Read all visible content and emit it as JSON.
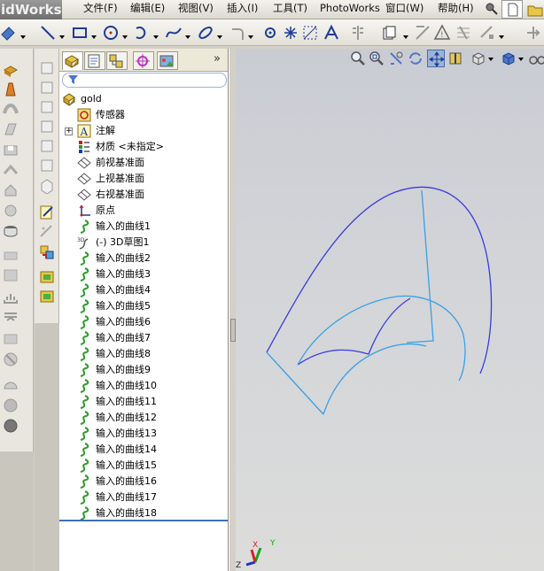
{
  "app": {
    "title": "idWorks"
  },
  "menu": {
    "items": [
      "文件(F)",
      "编辑(E)",
      "视图(V)",
      "插入(I)",
      "工具(T)",
      "PhotoWorks",
      "窗口(W)",
      "帮助(H)"
    ]
  },
  "colors": {
    "curve_dark": "#3a3adf",
    "curve_light": "#3aa0e6",
    "triad_x": "#d82020",
    "triad_y": "#20a020",
    "triad_z": "#2030c0",
    "selection_blue": "#3c6fb6"
  },
  "feature_manager": {
    "tabs": [
      "feature-manager-tab",
      "property-manager-tab",
      "configuration-manager-tab",
      "dimxpert-tab",
      "display-manager-tab"
    ],
    "more_label": "»",
    "tree": [
      {
        "label": "gold",
        "icon": "part-icon",
        "indent": 0
      },
      {
        "label": "传感器",
        "icon": "sensor-icon",
        "indent": 1
      },
      {
        "label": "注解",
        "icon": "annotation-icon",
        "indent": 1,
        "expandable": true,
        "expander": "+"
      },
      {
        "label": "材质 <未指定>",
        "icon": "material-icon",
        "indent": 1
      },
      {
        "label": "前视基准面",
        "icon": "plane-icon",
        "indent": 1
      },
      {
        "label": "上视基准面",
        "icon": "plane-icon",
        "indent": 1
      },
      {
        "label": "右视基准面",
        "icon": "plane-icon",
        "indent": 1
      },
      {
        "label": "原点",
        "icon": "origin-icon",
        "indent": 1
      },
      {
        "label": "输入的曲线1",
        "icon": "curve-icon",
        "indent": 1
      },
      {
        "label": "(-) 3D草图1",
        "icon": "sketch3d-icon",
        "indent": 1
      },
      {
        "label": "输入的曲线2",
        "icon": "curve-icon",
        "indent": 1
      },
      {
        "label": "输入的曲线3",
        "icon": "curve-icon",
        "indent": 1
      },
      {
        "label": "输入的曲线4",
        "icon": "curve-icon",
        "indent": 1
      },
      {
        "label": "输入的曲线5",
        "icon": "curve-icon",
        "indent": 1
      },
      {
        "label": "输入的曲线6",
        "icon": "curve-icon",
        "indent": 1
      },
      {
        "label": "输入的曲线7",
        "icon": "curve-icon",
        "indent": 1
      },
      {
        "label": "输入的曲线8",
        "icon": "curve-icon",
        "indent": 1
      },
      {
        "label": "输入的曲线9",
        "icon": "curve-icon",
        "indent": 1
      },
      {
        "label": "输入的曲线10",
        "icon": "curve-icon",
        "indent": 1
      },
      {
        "label": "输入的曲线11",
        "icon": "curve-icon",
        "indent": 1
      },
      {
        "label": "输入的曲线12",
        "icon": "curve-icon",
        "indent": 1
      },
      {
        "label": "输入的曲线13",
        "icon": "curve-icon",
        "indent": 1
      },
      {
        "label": "输入的曲线14",
        "icon": "curve-icon",
        "indent": 1
      },
      {
        "label": "输入的曲线15",
        "icon": "curve-icon",
        "indent": 1
      },
      {
        "label": "输入的曲线16",
        "icon": "curve-icon",
        "indent": 1
      },
      {
        "label": "输入的曲线17",
        "icon": "curve-icon",
        "indent": 1
      },
      {
        "label": "输入的曲线18",
        "icon": "curve-icon",
        "indent": 1
      }
    ]
  },
  "triad": {
    "x_label": "X",
    "y_label": "Y",
    "z_label": "Z"
  },
  "sketch_label": "3D"
}
